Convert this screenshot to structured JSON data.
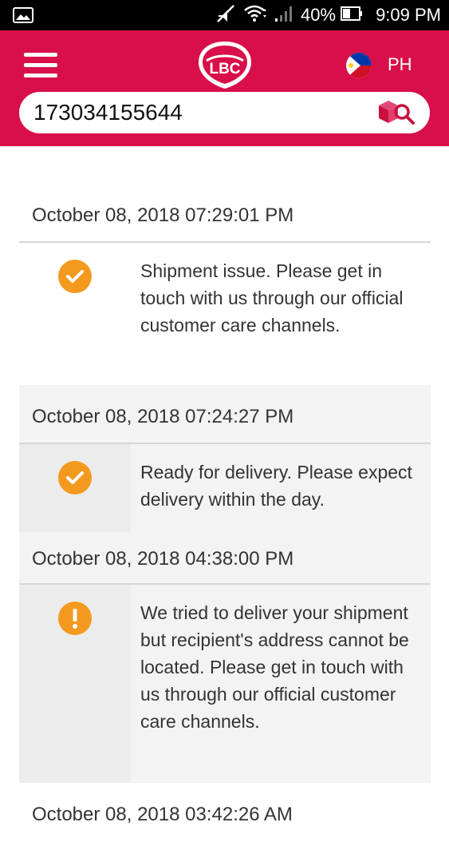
{
  "status_bar": {
    "battery": "40%",
    "time": "9:09 PM",
    "icons": [
      "gallery-icon",
      "mute-icon",
      "wifi-icon",
      "signal-icon",
      "battery-icon"
    ]
  },
  "header": {
    "brand": "LBC",
    "country": "PH",
    "accent_color": "#d80f4a",
    "icons": [
      "hamburger-menu-icon",
      "lbc-logo",
      "philippines-flag-icon",
      "package-search-icon"
    ]
  },
  "search": {
    "value": "173034155644"
  },
  "timeline": [
    {
      "timestamp": "October 08, 2018 07:29:01 PM",
      "status_icon": "check-icon",
      "message": "Shipment issue. Please get in touch with us through our official customer care channels."
    },
    {
      "timestamp": "October 08, 2018 07:24:27 PM",
      "status_icon": "check-icon",
      "message": "Ready for delivery. Please expect delivery within the day."
    },
    {
      "timestamp": "October 08, 2018 04:38:00 PM",
      "status_icon": "warning-icon",
      "message": "We tried to deliver your shipment but recipient's address cannot be located. Please get in touch with us through our official customer care channels."
    },
    {
      "timestamp": "October 08, 2018 03:42:26 AM"
    }
  ],
  "status_colors": {
    "icon": "#f39a1e"
  }
}
